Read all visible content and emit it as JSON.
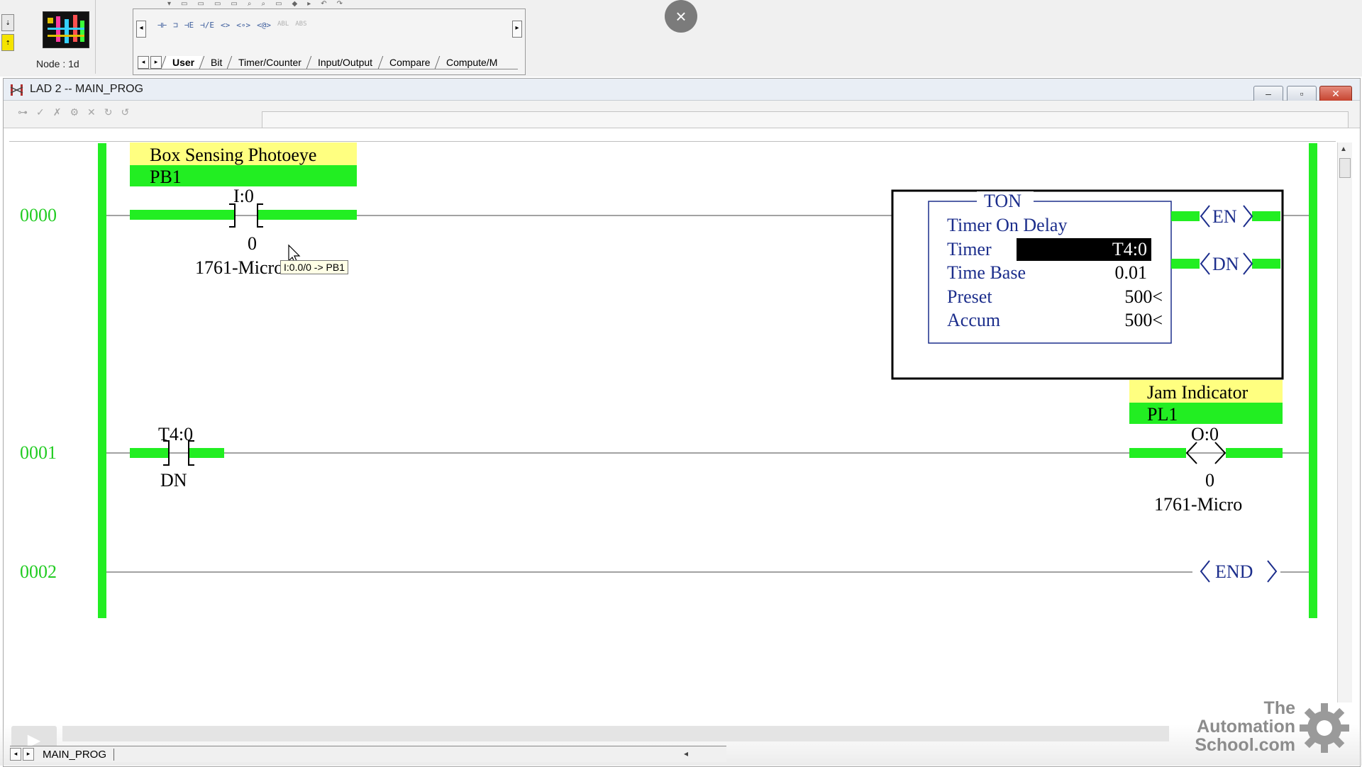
{
  "toolbar": {
    "node_label": "Node : 1d",
    "palette_tabs": [
      "User",
      "Bit",
      "Timer/Counter",
      "Input/Output",
      "Compare",
      "Compute/M"
    ],
    "palette_active_tab": "User",
    "palette_icons": [
      "⊣⊢",
      "⊐",
      "⊣E",
      "⊣/E",
      "<>",
      "<∘>",
      "<@>",
      "ABL",
      "ABS"
    ]
  },
  "window": {
    "title": "LAD 2 -- MAIN_PROG",
    "min_label": "‒",
    "max_label": "▫",
    "close_label": "✕"
  },
  "ladder": {
    "rung0": {
      "number": "0000",
      "contact": {
        "description": "Box Sensing Photoeye",
        "symbol": "PB1",
        "address_word": "I:0",
        "address_bit": "0",
        "module": "1761-Micro"
      },
      "ton": {
        "title": "TON",
        "name": "Timer On Delay",
        "timer_label": "Timer",
        "timer_value": "T4:0",
        "timebase_label": "Time Base",
        "timebase_value": "0.01",
        "preset_label": "Preset",
        "preset_value": "500<",
        "accum_label": "Accum",
        "accum_value": "500<",
        "en_label": "EN",
        "dn_label": "DN"
      }
    },
    "rung1": {
      "number": "0001",
      "contact": {
        "address": "T4:0",
        "bit": "DN"
      },
      "coil": {
        "description": "Jam Indicator",
        "symbol": "PL1",
        "address_word": "O:0",
        "address_bit": "0",
        "module": "1761-Micro"
      }
    },
    "rung2": {
      "number": "0002",
      "end_label": "END"
    }
  },
  "tooltip": {
    "text": "I:0.0/0 -> PB1"
  },
  "bottom": {
    "program_tab": "MAIN_PROG"
  },
  "watermark": {
    "line1": "The",
    "line2": "Automation",
    "line3": "School.com"
  },
  "colors": {
    "energized": "#22ee22",
    "description_bg": "#ffff80",
    "symbol_bg": "#22ee22",
    "rung_number": "#22cc22",
    "instruction_text": "#1c2e8c"
  }
}
